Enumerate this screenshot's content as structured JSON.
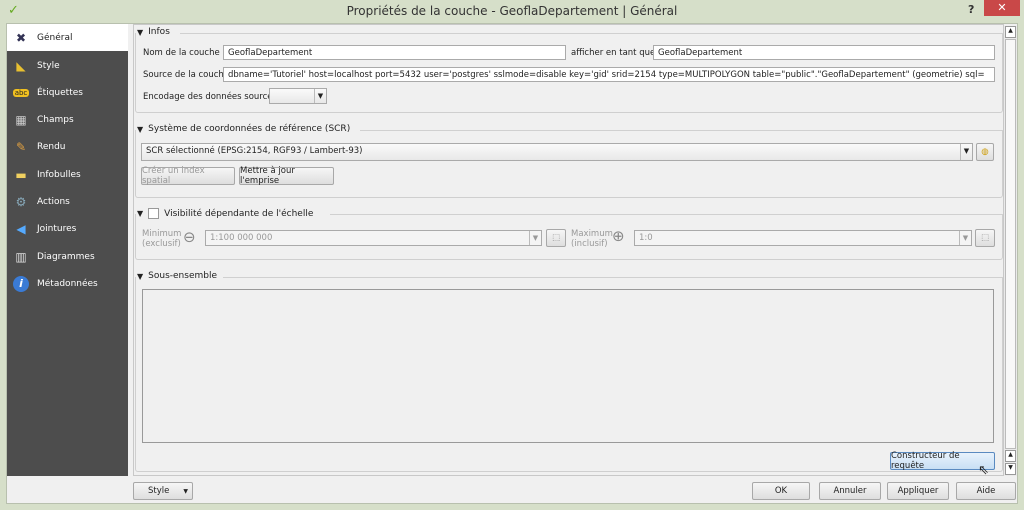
{
  "window": {
    "title": "Propriétés de la couche - GeoflaDepartement | Général",
    "help": "?",
    "close": "✕"
  },
  "sidebar": {
    "items": [
      {
        "label": "Général",
        "icon": "wrench-hammer-icon"
      },
      {
        "label": "Style",
        "icon": "style-brush-icon"
      },
      {
        "label": "Étiquettes",
        "icon": "abc-label-icon",
        "badge": "abc"
      },
      {
        "label": "Champs",
        "icon": "table-icon"
      },
      {
        "label": "Rendu",
        "icon": "paint-brush-icon"
      },
      {
        "label": "Infobulles",
        "icon": "speech-bubble-icon"
      },
      {
        "label": "Actions",
        "icon": "gear-icon"
      },
      {
        "label": "Jointures",
        "icon": "join-icon"
      },
      {
        "label": "Diagrammes",
        "icon": "chart-icon"
      },
      {
        "label": "Métadonnées",
        "icon": "info-icon",
        "badge": "i"
      }
    ]
  },
  "infos": {
    "title": "Infos",
    "name_label": "Nom de la couche",
    "name_value": "GeoflaDepartement",
    "display_label": "afficher en tant que",
    "display_value": "GeoflaDepartement",
    "source_label": "Source de la couche",
    "source_value": "dbname='Tutoriel' host=localhost port=5432 user='postgres' sslmode=disable key='gid' srid=2154 type=MULTIPOLYGON table=\"public\".\"GeoflaDepartement\" (geometrie) sql=",
    "encoding_label": "Encodage des données sources",
    "encoding_value": ""
  },
  "crs": {
    "title": "Système de coordonnées de référence (SCR)",
    "selected": "SCR sélectionné (EPSG:2154, RGF93 / Lambert-93)",
    "create_index": "Créer un index spatial",
    "update_extent": "Mettre à jour l'emprise"
  },
  "scale": {
    "title": "Visibilité dépendante de l'échelle",
    "checked": false,
    "min_label1": "Minimum",
    "min_label2": "(exclusif)",
    "min_value": "1:100 000 000",
    "max_label1": "Maximum",
    "max_label2": "(inclusif)",
    "max_value": "1:0"
  },
  "subset": {
    "title": "Sous-ensemble",
    "text": "",
    "query_builder": "Constructeur de requête"
  },
  "footer": {
    "style": "Style",
    "ok": "OK",
    "cancel": "Annuler",
    "apply": "Appliquer",
    "help": "Aide"
  }
}
